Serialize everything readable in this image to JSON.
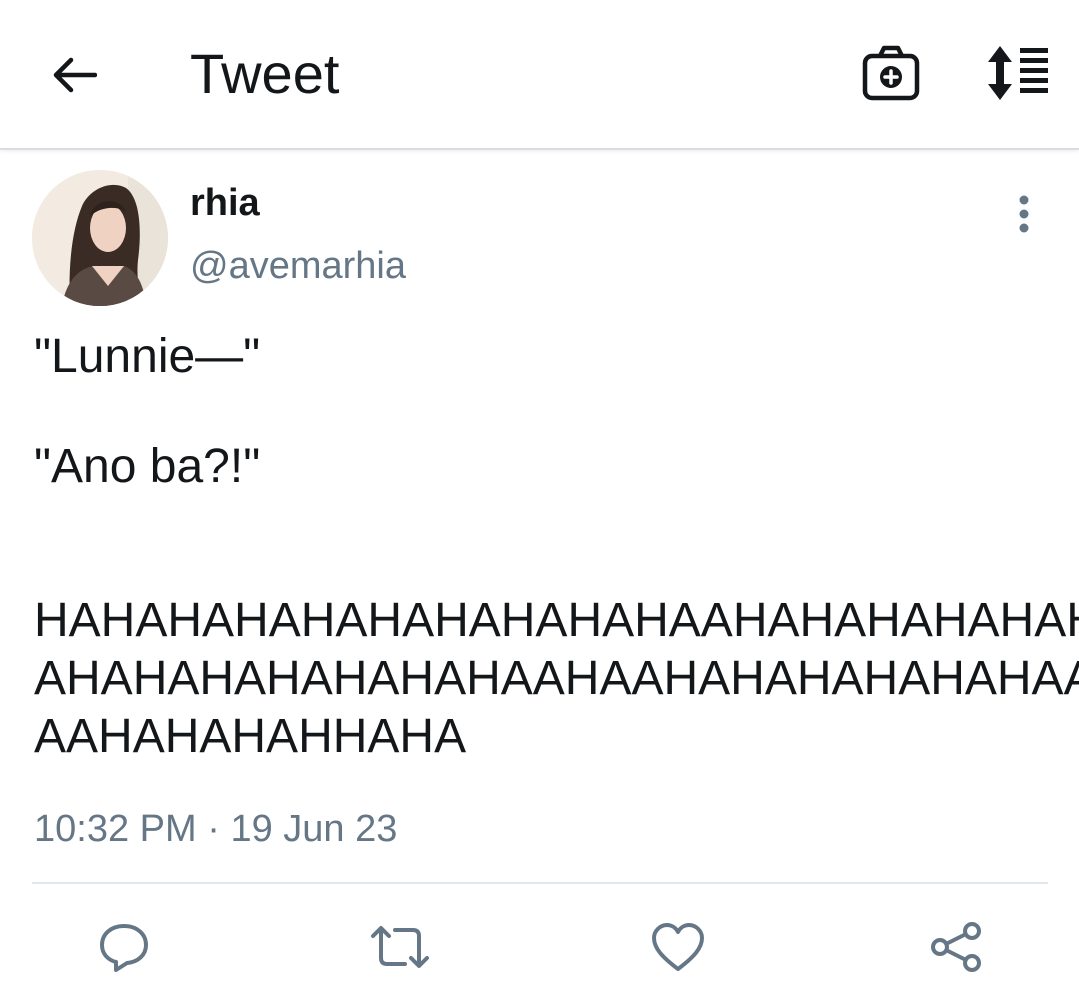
{
  "header": {
    "title": "Tweet",
    "back_icon": "arrow-left-icon",
    "camera_icon": "camera-plus-icon",
    "sort_icon": "sort-list-icon"
  },
  "tweet": {
    "author": {
      "display_name": "rhia",
      "handle": "@avemarhia",
      "avatar": "avatar-photo"
    },
    "text_lines": [
      "\"Lunnie—\"",
      "\"Ano ba?!\"",
      "HAHAHAHAHAHAHAHAHAHAAHAHAHAHAHAH\nAHAHAHAHAHAHAHAAHAAHAHAHAHAHAHAA\nAAHAHAHAHHAHA"
    ],
    "time": "10:32 PM",
    "separator": "·",
    "date": "19 Jun 23",
    "more_icon": "more-vertical-icon"
  },
  "actions": {
    "reply_icon": "reply-icon",
    "retweet_icon": "retweet-icon",
    "like_icon": "heart-icon",
    "share_icon": "share-icon"
  },
  "colors": {
    "text": "#14171a",
    "secondary": "#657786",
    "divider": "#e1e8ed"
  }
}
